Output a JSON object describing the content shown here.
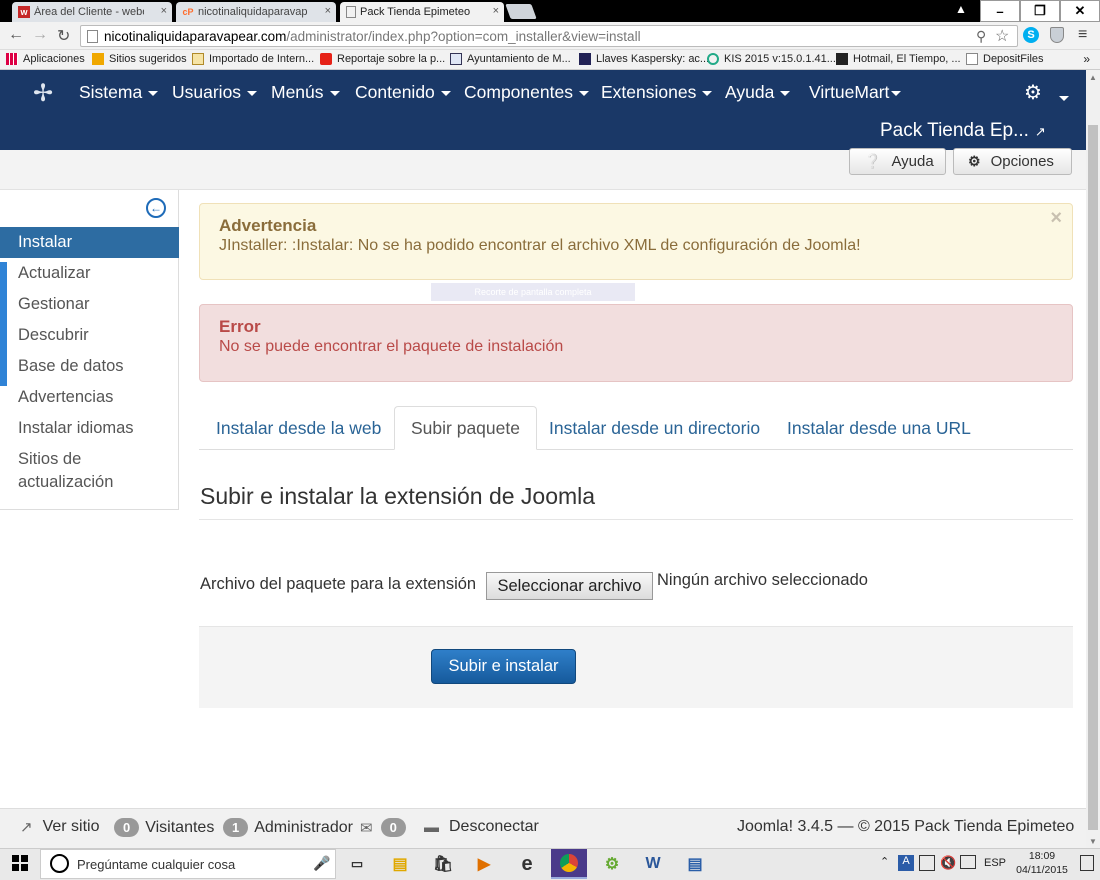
{
  "browser": {
    "tabs": [
      {
        "label": "Área del Cliente - webem",
        "fav": "w",
        "favColor": "#c62828"
      },
      {
        "label": "nicotinaliquidaparavapear",
        "fav": "cP",
        "favColor": "#ff6c2c"
      },
      {
        "label": "Pack Tienda Epimeteo - A",
        "fav": "",
        "favColor": "#888"
      }
    ],
    "url_domain": "nicotinaliquidaparavapear.com",
    "url_path": "/administrator/index.php?option=com_installer&view=install",
    "bookmarks": [
      "Aplicaciones",
      "Sitios sugeridos",
      "Importado de Intern...",
      "Reportaje sobre la p...",
      "Ayuntamiento de M...",
      "Llaves Kaspersky: ac...",
      "KIS 2015 v:15.0.1.41...",
      "Hotmail, El Tiempo, ...",
      "DepositFiles"
    ],
    "bookmarks_more": "»"
  },
  "joomla": {
    "menu": [
      "Sistema",
      "Usuarios",
      "Menús",
      "Contenido",
      "Componentes",
      "Extensiones",
      "Ayuda",
      "VirtueMart"
    ],
    "site_name": "Pack Tienda Ep...",
    "toolbar": {
      "help": "Ayuda",
      "options": "Opciones"
    },
    "sidebar": [
      "Instalar",
      "Actualizar",
      "Gestionar",
      "Descubrir",
      "Base de datos",
      "Advertencias",
      "Instalar idiomas",
      "Sitios de",
      "actualización"
    ],
    "warning": {
      "heading": "Advertencia",
      "message": "JInstaller: :Instalar: No se ha podido encontrar el archivo XML de configuración de Joomla!",
      "close": "×"
    },
    "snip_overlay": "Recorte de pantalla completa",
    "error": {
      "heading": "Error",
      "message": "No se puede encontrar el paquete de instalación"
    },
    "tabs": [
      "Instalar desde la web",
      "Subir paquete",
      "Instalar desde un directorio",
      "Instalar desde una URL"
    ],
    "legend": "Subir e instalar la extensión de Joomla",
    "file_label": "Archivo del paquete para la extensión",
    "file_button": "Seleccionar archivo",
    "file_status": "Ningún archivo seleccionado",
    "submit": "Subir e instalar",
    "status": {
      "view_site": "Ver sitio",
      "visitors_count": "0",
      "visitors": "Visitantes",
      "admin_count": "1",
      "admin": "Administrador",
      "msg_count": "0",
      "logout": "Desconectar",
      "version": "Joomla! 3.4.5 — © 2015 Pack Tienda Epimeteo"
    }
  },
  "taskbar": {
    "search_placeholder": "Pregúntame cualquier cosa",
    "lang": "ESP",
    "time": "18:09",
    "date": "04/11/2015"
  }
}
